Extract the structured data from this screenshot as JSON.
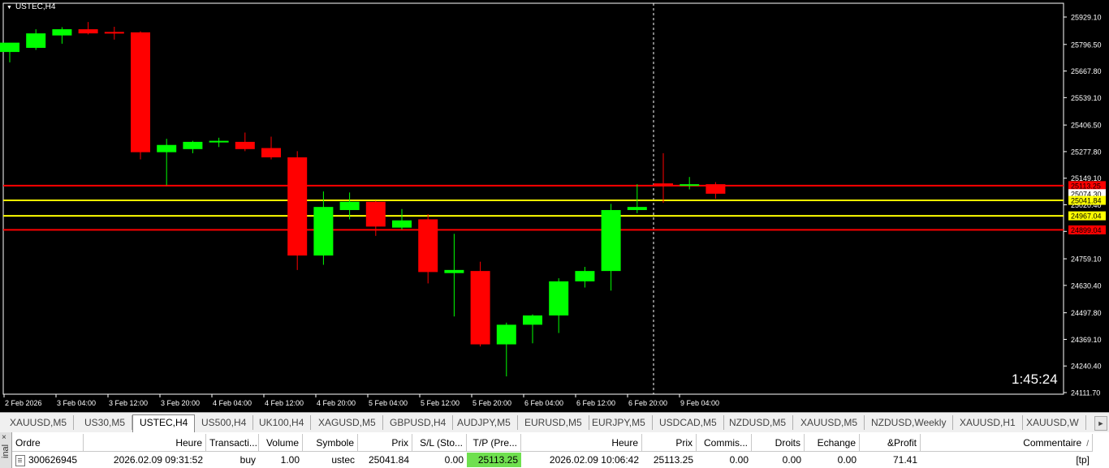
{
  "chart": {
    "title": "USTEC,H4",
    "timer": "1:45:24",
    "colors": {
      "background": "#000000",
      "bull": "#00ff00",
      "bear": "#ff0000",
      "axis": "#ffffff",
      "sl_tp_line": "#ff0000",
      "entry_line": "#ffff00"
    },
    "price_labels": [
      "25929.10",
      "25796.50",
      "25667.80",
      "25539.10",
      "25406.50",
      "25277.80",
      "25149.10",
      "25020.40",
      "24891.70",
      "24759.10",
      "24630.40",
      "24497.80",
      "24369.10",
      "24240.40",
      "24111.70"
    ],
    "time_labels": [
      "2 Feb 2026",
      "3 Feb 04:00",
      "3 Feb 12:00",
      "3 Feb 20:00",
      "4 Feb 04:00",
      "4 Feb 12:00",
      "4 Feb 20:00",
      "5 Feb 04:00",
      "5 Feb 12:00",
      "5 Feb 20:00",
      "6 Feb 04:00",
      "6 Feb 12:00",
      "6 Feb 20:00",
      "9 Feb 04:00"
    ],
    "level_lines": [
      {
        "price": 25113.25,
        "label": "25113.25",
        "color": "#ff0000"
      },
      {
        "price": 25041.84,
        "label": "25041.84",
        "color": "#ffff00"
      },
      {
        "price": 24967.04,
        "label": "24967.04",
        "color": "#ffff00"
      },
      {
        "price": 24899.04,
        "label": "24899.04",
        "color": "#ff0000"
      }
    ],
    "current_price_label": "25074.30",
    "candles": [
      {
        "o": 25760,
        "h": 25800,
        "l": 25710,
        "c": 25805
      },
      {
        "o": 25780,
        "h": 25870,
        "l": 25770,
        "c": 25850
      },
      {
        "o": 25840,
        "h": 25880,
        "l": 25800,
        "c": 25870
      },
      {
        "o": 25870,
        "h": 25905,
        "l": 25845,
        "c": 25850
      },
      {
        "o": 25857,
        "h": 25882,
        "l": 25820,
        "c": 25855
      },
      {
        "o": 25855,
        "h": 25860,
        "l": 25240,
        "c": 25275
      },
      {
        "o": 25275,
        "h": 25340,
        "l": 25115,
        "c": 25310
      },
      {
        "o": 25290,
        "h": 25330,
        "l": 25270,
        "c": 25325
      },
      {
        "o": 25325,
        "h": 25345,
        "l": 25300,
        "c": 25330
      },
      {
        "o": 25325,
        "h": 25370,
        "l": 25280,
        "c": 25290
      },
      {
        "o": 25295,
        "h": 25350,
        "l": 25240,
        "c": 25250
      },
      {
        "o": 25250,
        "h": 25280,
        "l": 24705,
        "c": 24775
      },
      {
        "o": 24775,
        "h": 25085,
        "l": 24730,
        "c": 25010
      },
      {
        "o": 24995,
        "h": 25080,
        "l": 24950,
        "c": 25035
      },
      {
        "o": 25035,
        "h": 25040,
        "l": 24870,
        "c": 24915
      },
      {
        "o": 24910,
        "h": 25000,
        "l": 24900,
        "c": 24945
      },
      {
        "o": 24950,
        "h": 24975,
        "l": 24640,
        "c": 24695
      },
      {
        "o": 24690,
        "h": 24880,
        "l": 24480,
        "c": 24705
      },
      {
        "o": 24700,
        "h": 24745,
        "l": 24335,
        "c": 24345
      },
      {
        "o": 24345,
        "h": 24450,
        "l": 24190,
        "c": 24440
      },
      {
        "o": 24440,
        "h": 24490,
        "l": 24350,
        "c": 24485
      },
      {
        "o": 24485,
        "h": 24665,
        "l": 24400,
        "c": 24650
      },
      {
        "o": 24650,
        "h": 24720,
        "l": 24620,
        "c": 24700
      },
      {
        "o": 24700,
        "h": 25025,
        "l": 24605,
        "c": 24995
      },
      {
        "o": 24995,
        "h": 25120,
        "l": 24980,
        "c": 25010
      },
      {
        "o": 25124,
        "h": 25270,
        "l": 25030,
        "c": 25120
      },
      {
        "o": 25120,
        "h": 25155,
        "l": 25095,
        "c": 25120
      },
      {
        "o": 25120,
        "h": 25130,
        "l": 25050,
        "c": 25074
      }
    ]
  },
  "tabs": [
    "XAUUSD,M5",
    "US30,M5",
    "USTEC,H4",
    "US500,H4",
    "UK100,H4",
    "XAGUSD,M5",
    "GBPUSD,H4",
    "AUDJPY,M5",
    "EURUSD,M5",
    "EURJPY,M5",
    "USDCAD,M5",
    "NZDUSD,M5",
    "XAUUSD,M5",
    "NZDUSD,Weekly",
    "XAUUSD,H1",
    "XAUUSD,W"
  ],
  "active_tab": 2,
  "terminal": {
    "side_label": "inal",
    "headers": [
      "Ordre",
      "Heure",
      "Transacti...",
      "Volume",
      "Symbole",
      "Prix",
      "S/L (Sto...",
      "T/P (Pre...",
      "Heure",
      "Prix",
      "Commis...",
      "Droits",
      "Echange",
      "&Profit",
      "Commentaire"
    ],
    "sort_arrow": "/",
    "row": [
      "300626945",
      "2026.02.09 09:31:52",
      "buy",
      "1.00",
      "ustec",
      "25041.84",
      "0.00",
      "25113.25",
      "2026.02.09 10:06:42",
      "25113.25",
      "0.00",
      "0.00",
      "0.00",
      "71.41",
      "[tp]"
    ]
  }
}
